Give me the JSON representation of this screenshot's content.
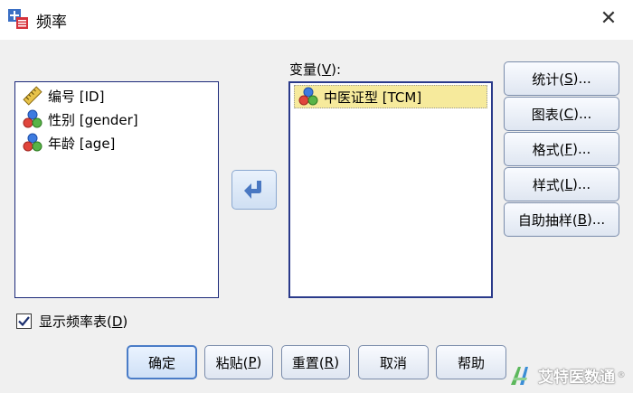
{
  "window": {
    "title": "频率",
    "close_icon": "close-icon"
  },
  "source_list": {
    "items": [
      {
        "label": "编号 [ID]",
        "icon": "ruler-scale-icon"
      },
      {
        "label": "性别 [gender]",
        "icon": "nominal-variable-icon"
      },
      {
        "label": "年龄 [age]",
        "icon": "nominal-variable-icon"
      }
    ]
  },
  "target": {
    "label_prefix": "变量(",
    "label_key": "V",
    "label_suffix": "):",
    "items": [
      {
        "label": "中医证型 [TCM]",
        "icon": "nominal-variable-icon",
        "selected": true
      }
    ]
  },
  "side_buttons": [
    {
      "pre": "统计(",
      "key": "S",
      "post": ")..."
    },
    {
      "pre": "图表(",
      "key": "C",
      "post": ")..."
    },
    {
      "pre": "格式(",
      "key": "F",
      "post": ")..."
    },
    {
      "pre": "样式(",
      "key": "L",
      "post": ")..."
    },
    {
      "pre": "自助抽样(",
      "key": "B",
      "post": ")..."
    }
  ],
  "checkbox": {
    "pre": "显示频率表(",
    "key": "D",
    "post": ")",
    "checked": true
  },
  "bottom_buttons": [
    {
      "label": "确定"
    },
    {
      "pre": "粘贴(",
      "key": "P",
      "post": ")"
    },
    {
      "pre": "重置(",
      "key": "R",
      "post": ")"
    },
    {
      "label": "取消"
    },
    {
      "label": "帮助"
    }
  ],
  "watermark": {
    "text": "艾特医数通",
    "mark": "®"
  },
  "colors": {
    "selection": "#f6ea9c",
    "list_border": "#1c2a7a",
    "move_button": "#4a78c2"
  }
}
